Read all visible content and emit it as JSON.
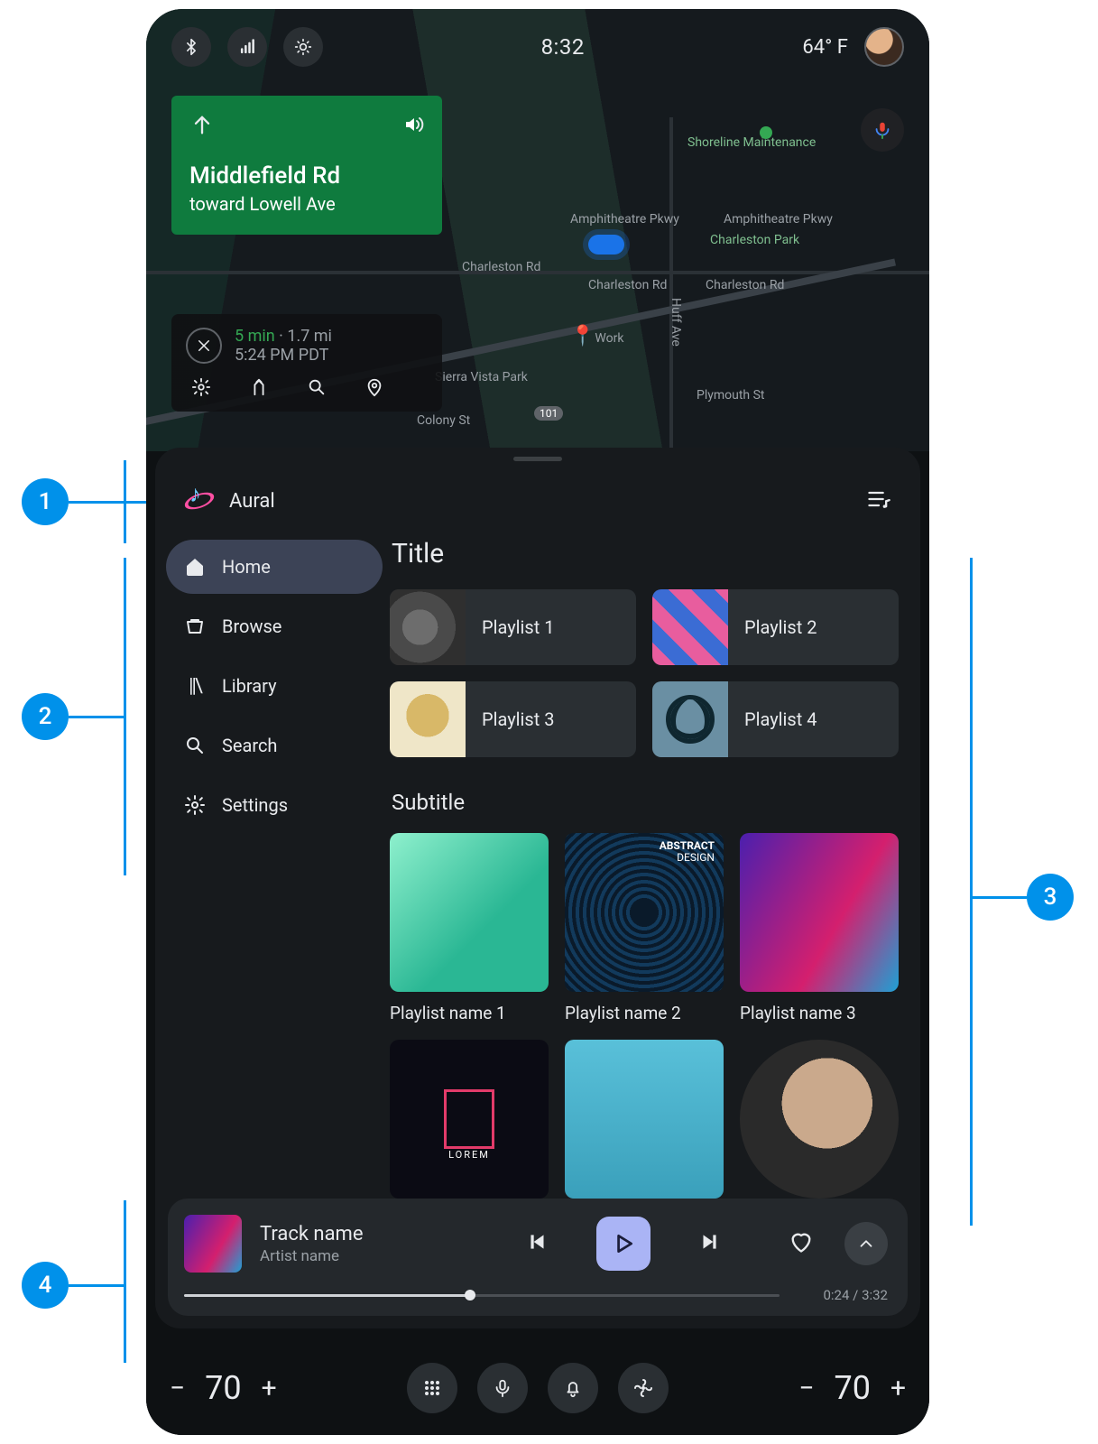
{
  "statusbar": {
    "time": "8:32",
    "temperature": "64° F"
  },
  "map": {
    "nav_card": {
      "street": "Middlefield Rd",
      "toward": "toward Lowell Ave"
    },
    "eta": {
      "duration": "5 min",
      "distance": "1.7 mi",
      "arrival": "5:24 PM PDT"
    },
    "labels": {
      "amph1": "Amphitheatre Pkwy",
      "amph2": "Amphitheatre Pkwy",
      "chr1": "Charleston Rd",
      "chr2": "Charleston Rd",
      "chr3": "Charleston Rd",
      "huff": "Huff Ave",
      "plymouth": "Plymouth St",
      "colony": "Colony St",
      "sierra": "Sierra Vista Park",
      "charleston_park": "Charleston Park",
      "shoreline": "Shoreline Maintenance",
      "work": "Work",
      "hwy": "101"
    }
  },
  "media": {
    "app_name": "Aural",
    "rail": {
      "home": "Home",
      "browse": "Browse",
      "library": "Library",
      "search": "Search",
      "settings": "Settings"
    },
    "section_title": "Title",
    "playlists_wide": [
      {
        "label": "Playlist 1"
      },
      {
        "label": "Playlist 2"
      },
      {
        "label": "Playlist 3"
      },
      {
        "label": "Playlist 4"
      }
    ],
    "subtitle": "Subtitle",
    "playlists_sq": [
      {
        "label": "Playlist name 1"
      },
      {
        "label": "Playlist name 2",
        "overlay_top": "ABSTRACT",
        "overlay_bottom": "DESIGN"
      },
      {
        "label": "Playlist name 3"
      }
    ],
    "row2_overlay": "LOREM",
    "now_playing": {
      "title": "Track name",
      "artist": "Artist name",
      "elapsed": "0:24",
      "total": "3:32",
      "progress_pct": 48
    }
  },
  "sysbar": {
    "temp_left": "70",
    "temp_right": "70"
  },
  "annotations": {
    "n1": "1",
    "n2": "2",
    "n3": "3",
    "n4": "4"
  }
}
